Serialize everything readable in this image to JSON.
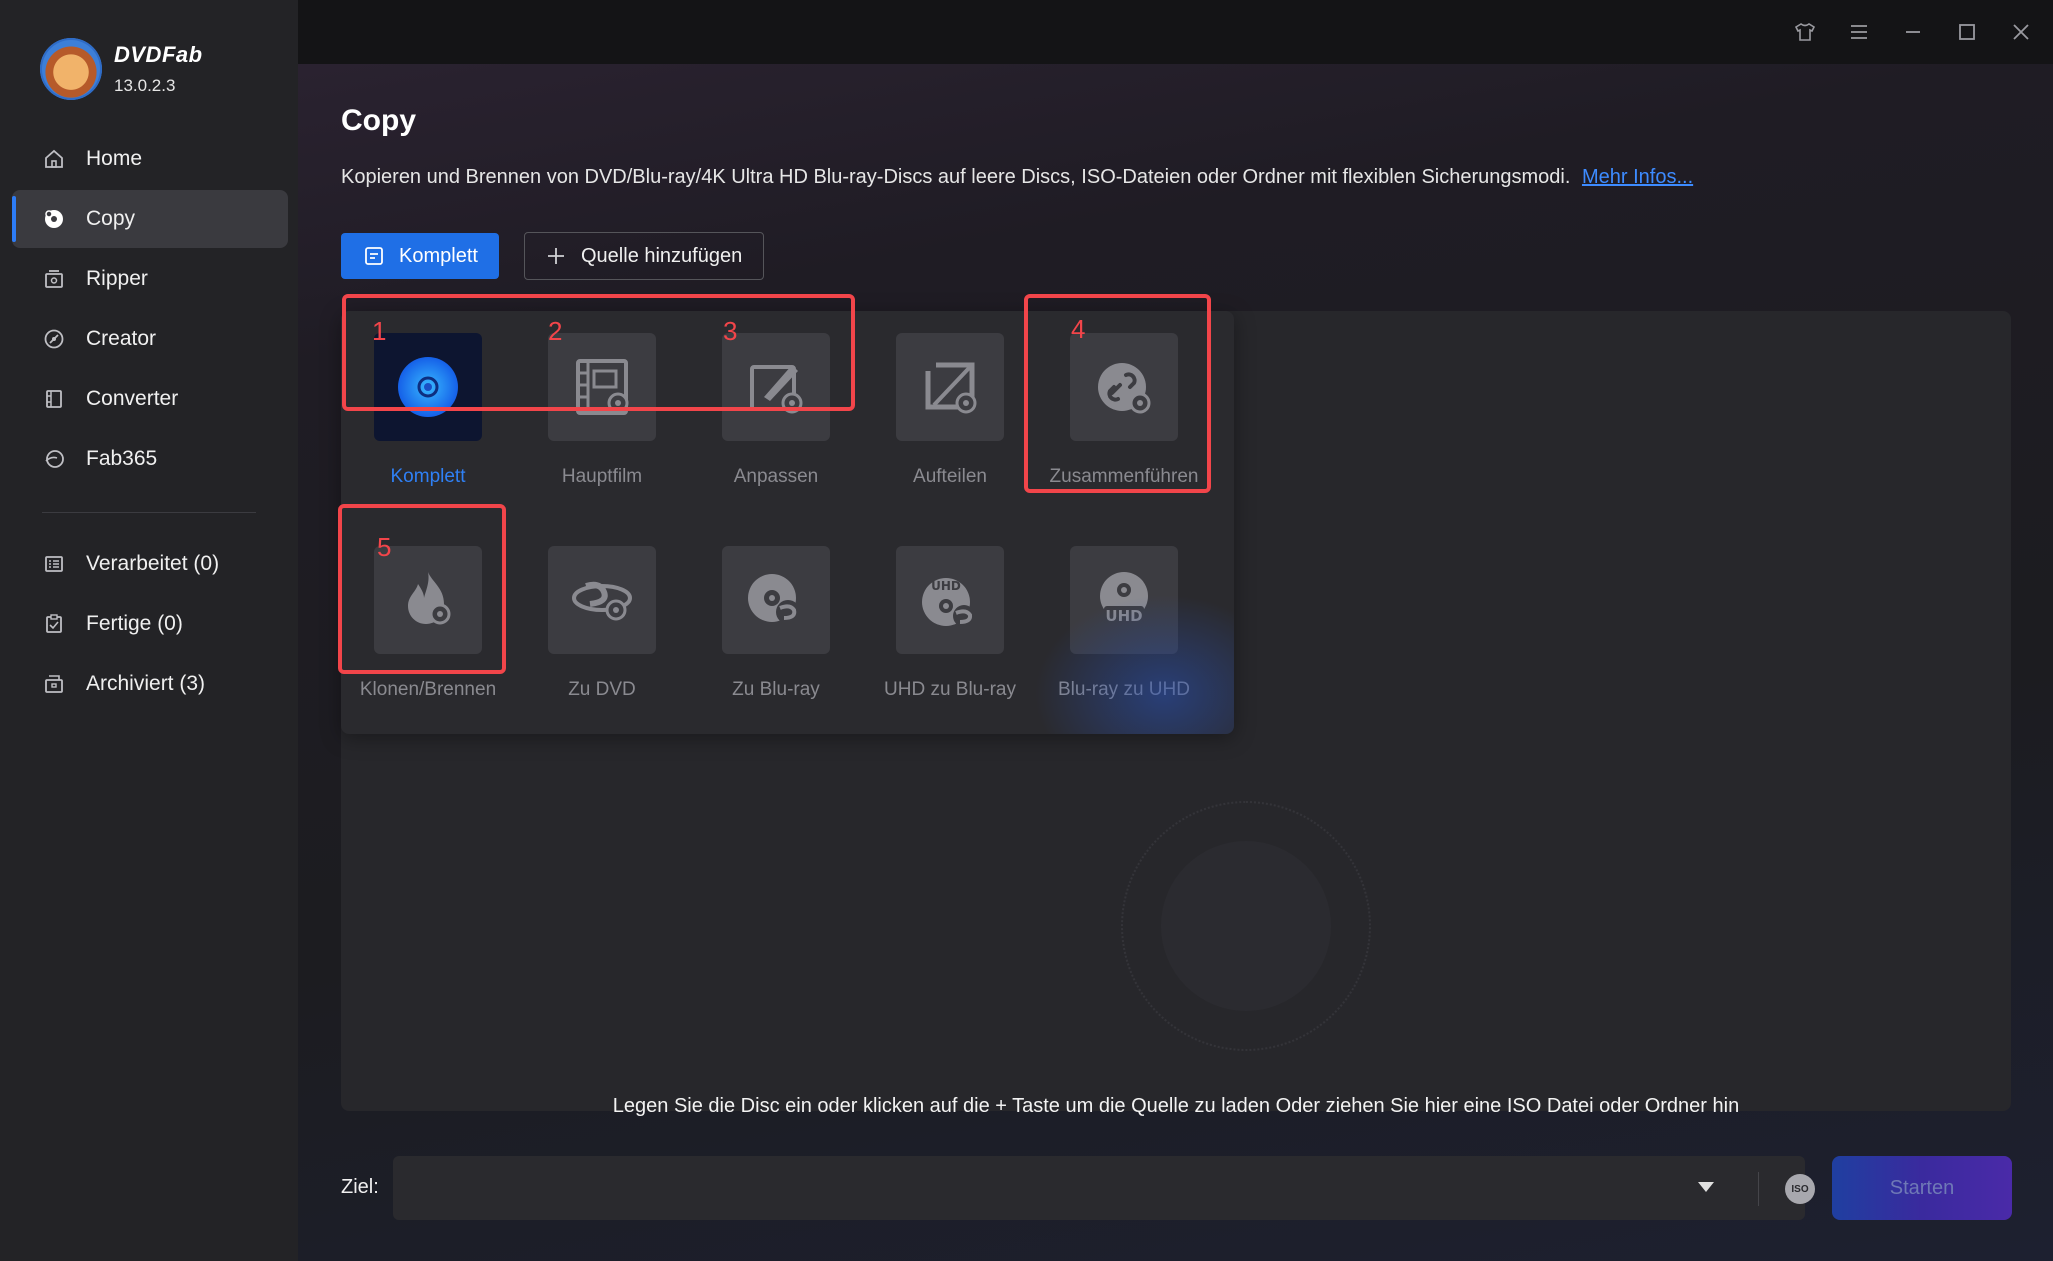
{
  "app": {
    "name": "DVDFab",
    "version": "13.0.2.3"
  },
  "sidebar": {
    "items": [
      {
        "label": "Home",
        "icon": "home-icon"
      },
      {
        "label": "Copy",
        "icon": "copy-disc-icon",
        "active": true
      },
      {
        "label": "Ripper",
        "icon": "ripper-icon"
      },
      {
        "label": "Creator",
        "icon": "creator-icon"
      },
      {
        "label": "Converter",
        "icon": "converter-icon"
      },
      {
        "label": "Fab365",
        "icon": "fab365-icon"
      }
    ],
    "queue_items": [
      {
        "label": "Verarbeitet (0)",
        "icon": "processing-list-icon"
      },
      {
        "label": "Fertige (0)",
        "icon": "finished-clipboard-icon"
      },
      {
        "label": "Archiviert (3)",
        "icon": "archive-icon"
      }
    ]
  },
  "page": {
    "title": "Copy",
    "description": "Kopieren und Brennen von DVD/Blu-ray/4K Ultra HD Blu-ray-Discs auf leere Discs, ISO-Dateien oder Ordner mit flexiblen Sicherungsmodi.",
    "more_link": "Mehr Infos..."
  },
  "toolbar": {
    "mode_button": "Komplett",
    "add_source": "Quelle hinzufügen"
  },
  "modes": [
    {
      "label": "Komplett",
      "icon": "full-disc-icon",
      "selected": true
    },
    {
      "label": "Hauptfilm",
      "icon": "main-movie-icon"
    },
    {
      "label": "Anpassen",
      "icon": "customize-icon"
    },
    {
      "label": "Aufteilen",
      "icon": "split-icon"
    },
    {
      "label": "Zusammenführen",
      "icon": "merge-icon"
    },
    {
      "label": "Klonen/Brennen",
      "icon": "clone-burn-icon"
    },
    {
      "label": "Zu DVD",
      "icon": "to-dvd-icon"
    },
    {
      "label": "Zu Blu-ray",
      "icon": "to-bluray-icon"
    },
    {
      "label": "UHD zu Blu-ray",
      "icon": "uhd-to-bluray-icon"
    },
    {
      "label": "Blu-ray zu UHD",
      "icon": "bluray-to-uhd-icon"
    }
  ],
  "annotations": {
    "numbers": [
      "1",
      "2",
      "3",
      "4",
      "5"
    ],
    "color": "#f2454a"
  },
  "drop_hint": "Legen Sie die Disc ein oder klicken auf die + Taste um die Quelle zu laden Oder ziehen Sie hier eine ISO Datei oder Ordner hin",
  "output": {
    "label": "Ziel:",
    "value": "",
    "iso_label": "ISO",
    "start_button": "Starten"
  },
  "colors": {
    "accent": "#1f6fe6",
    "link": "#3d8bff",
    "selected_text": "#2f80f5"
  }
}
